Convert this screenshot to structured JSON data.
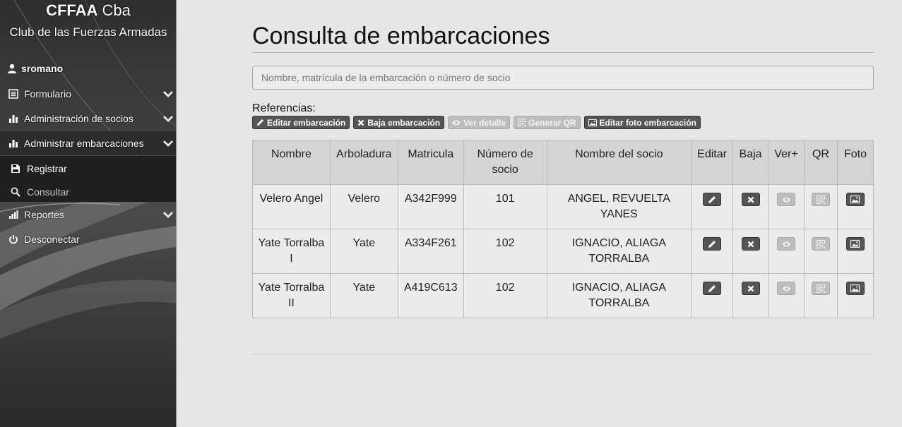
{
  "sidebar": {
    "brand_bold": "CFFAA",
    "brand_rest": " Cba",
    "brand_sub": "Club de las Fuerzas Armadas",
    "user": "sromano",
    "items": [
      {
        "label": "Formulario",
        "icon": "list-icon"
      },
      {
        "label": "Administración de socios",
        "icon": "bar-chart-icon"
      },
      {
        "label": "Administrar embarcaciones",
        "icon": "bar-chart-icon"
      },
      {
        "label": "Reportes",
        "icon": "signal-icon"
      },
      {
        "label": "Desconectar",
        "icon": "power-icon"
      }
    ],
    "submenu": [
      {
        "label": "Registrar",
        "icon": "register-icon"
      },
      {
        "label": "Consultar",
        "icon": "search-icon"
      }
    ]
  },
  "main": {
    "title": "Consulta de embarcaciones",
    "search_placeholder": "Nombre, matrícula de la embarcación o número de socio",
    "refs_label": "Referencias:",
    "refs": [
      {
        "label": "Editar embarcación",
        "icon": "pencil-icon",
        "style": "dark"
      },
      {
        "label": "Baja embarcación",
        "icon": "close-icon",
        "style": "dark"
      },
      {
        "label": "Ver detalle",
        "icon": "eye-icon",
        "style": "light"
      },
      {
        "label": "Generar QR",
        "icon": "qr-icon",
        "style": "light"
      },
      {
        "label": "Editar foto embarcación",
        "icon": "picture-icon",
        "style": "dark"
      }
    ],
    "table": {
      "headers": [
        "Nombre",
        "Arboladura",
        "Matricula",
        "Número de socio",
        "Nombre del socio",
        "Editar",
        "Baja",
        "Ver+",
        "QR",
        "Foto"
      ],
      "rows": [
        {
          "nombre": "Velero Angel",
          "arboladura": "Velero",
          "matricula": "A342F999",
          "numero": "101",
          "socio": "ANGEL, REVUELTA YANES"
        },
        {
          "nombre": "Yate Torralba I",
          "arboladura": "Yate",
          "matricula": "A334F261",
          "numero": "102",
          "socio": "IGNACIO, ALIAGA TORRALBA"
        },
        {
          "nombre": "Yate Torralba II",
          "arboladura": "Yate",
          "matricula": "A419C613",
          "numero": "102",
          "socio": "IGNACIO, ALIAGA TORRALBA"
        }
      ]
    }
  },
  "colors": {
    "sidebar_bg": "#3a3a3a",
    "main_bg": "#e6e6e6",
    "button_dark": "#555555",
    "button_disabled": "#bdbdbd"
  }
}
